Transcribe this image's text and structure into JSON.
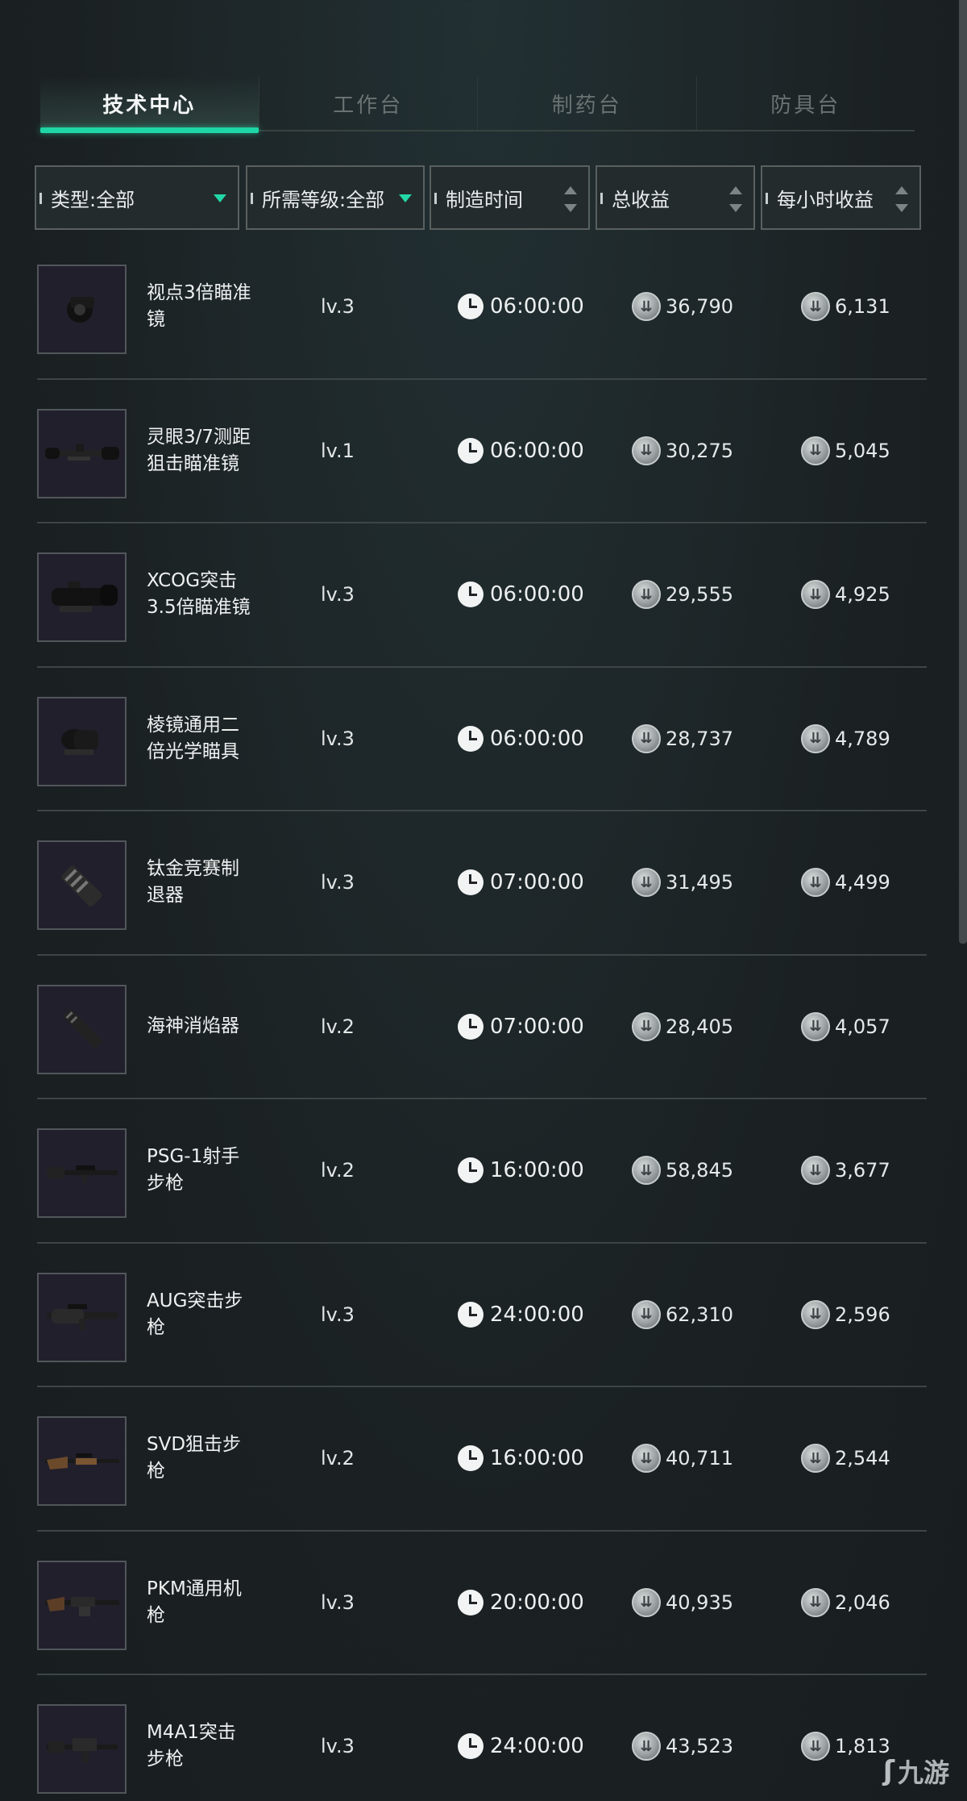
{
  "tabs": [
    {
      "label": "技术中心",
      "active": true
    },
    {
      "label": "工作台",
      "active": false
    },
    {
      "label": "制药台",
      "active": false
    },
    {
      "label": "防具台",
      "active": false
    }
  ],
  "filters": {
    "type": "类型:全部",
    "level": "所需等级:全部",
    "time": "制造时间",
    "total": "总收益",
    "hourly": "每小时收益"
  },
  "rows": [
    {
      "name": "视点3倍瞄准镜",
      "level": "lv.3",
      "time": "06:00:00",
      "total": "36,790",
      "hourly": "6,131",
      "icon": "compact-scope-icon"
    },
    {
      "name": "灵眼3/7测距狙击瞄准镜",
      "level": "lv.1",
      "time": "06:00:00",
      "total": "30,275",
      "hourly": "5,045",
      "icon": "long-scope-icon"
    },
    {
      "name": "XCOG突击3.5倍瞄准镜",
      "level": "lv.3",
      "time": "06:00:00",
      "total": "29,555",
      "hourly": "4,925",
      "icon": "acog-scope-icon"
    },
    {
      "name": "棱镜通用二倍光学瞄具",
      "level": "lv.3",
      "time": "06:00:00",
      "total": "28,737",
      "hourly": "4,789",
      "icon": "prism-sight-icon"
    },
    {
      "name": "钛金竞赛制退器",
      "level": "lv.3",
      "time": "07:00:00",
      "total": "31,495",
      "hourly": "4,499",
      "icon": "muzzle-brake-icon"
    },
    {
      "name": "海神消焰器",
      "level": "lv.2",
      "time": "07:00:00",
      "total": "28,405",
      "hourly": "4,057",
      "icon": "flash-hider-icon"
    },
    {
      "name": "PSG-1射手步枪",
      "level": "lv.2",
      "time": "16:00:00",
      "total": "58,845",
      "hourly": "3,677",
      "icon": "psg1-rifle-icon"
    },
    {
      "name": "AUG突击步枪",
      "level": "lv.3",
      "time": "24:00:00",
      "total": "62,310",
      "hourly": "2,596",
      "icon": "aug-rifle-icon"
    },
    {
      "name": "SVD狙击步枪",
      "level": "lv.2",
      "time": "16:00:00",
      "total": "40,711",
      "hourly": "2,544",
      "icon": "svd-rifle-icon"
    },
    {
      "name": "PKM通用机枪",
      "level": "lv.3",
      "time": "20:00:00",
      "total": "40,935",
      "hourly": "2,046",
      "icon": "pkm-machinegun-icon"
    },
    {
      "name": "M4A1突击步枪",
      "level": "lv.3",
      "time": "24:00:00",
      "total": "43,523",
      "hourly": "1,813",
      "icon": "m4a1-rifle-icon"
    }
  ],
  "colors": {
    "accent": "#1fd6a6",
    "background": "#1c2325"
  },
  "watermark": "九游"
}
